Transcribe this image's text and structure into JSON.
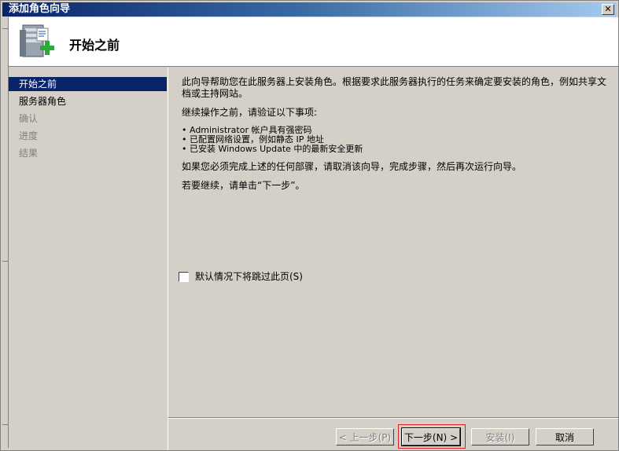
{
  "window": {
    "title": "添加角色向导",
    "close_glyph": "✕"
  },
  "header": {
    "heading": "开始之前",
    "icon": "server-roles-add-icon"
  },
  "sidebar": {
    "items": [
      {
        "label": "开始之前",
        "state": "active"
      },
      {
        "label": "服务器角色",
        "state": "enabled"
      },
      {
        "label": "确认",
        "state": "disabled"
      },
      {
        "label": "进度",
        "state": "disabled"
      },
      {
        "label": "结果",
        "state": "disabled"
      }
    ]
  },
  "content": {
    "intro": "此向导帮助您在此服务器上安装角色。根据要求此服务器执行的任务来确定要安装的角色，例如共享文档或主持网站。",
    "verify_heading": "继续操作之前，请验证以下事项:",
    "bullets": [
      "• Administrator 帐户具有强密码",
      "• 已配置网络设置，例如静态 IP 地址",
      "• 已安装 Windows Update 中的最新安全更新"
    ],
    "cancel_note": "如果您必须完成上述的任何部骤，请取消该向导，完成步骤，然后再次运行向导。",
    "continue_note": "若要继续，请单击“下一步”。"
  },
  "skip_checkbox": {
    "label": "默认情况下将跳过此页(S)",
    "checked": false
  },
  "buttons": {
    "back": "< 上一步(P)",
    "next": "下一步(N) >",
    "install": "安装(I)",
    "cancel": "取消"
  },
  "colors": {
    "title_bar": "#0a246a",
    "selection": "#0a246a",
    "face": "#d4d0c8",
    "highlight_box": "#e02020"
  }
}
